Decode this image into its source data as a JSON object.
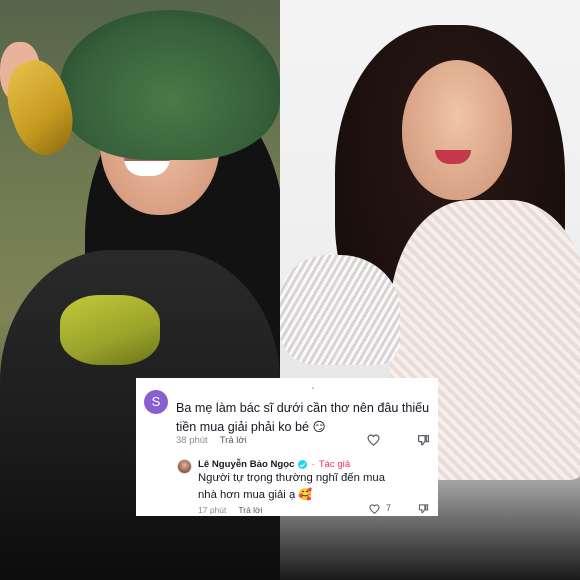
{
  "comments": [
    {
      "avatar_letter": "S",
      "avatar_color": "#8a5fd0",
      "text": "Ba mẹ làm bác sĩ dưới cần thơ nên đâu thiếu tiền mua giải phải ko bé 😏",
      "time": "38 phút",
      "reply_label": "Trả lời",
      "icons": [
        "heart-icon",
        "dislike-icon"
      ]
    }
  ],
  "reply": {
    "author": "Lê Nguyễn Bảo Ngọc",
    "separator": "·",
    "author_tag": "Tác giả",
    "text": "Người tự trọng thường nghĩ đến mua nhà hơn mua giải ạ 🥰",
    "time": "17 phút",
    "reply_label": "Trả lời",
    "likes": "7",
    "accent_color": "#fe2c55",
    "verified_color": "#20d5ec",
    "icons": [
      "heart-icon",
      "dislike-icon",
      "verified-badge-icon"
    ]
  },
  "card_top_glyph": "˛"
}
